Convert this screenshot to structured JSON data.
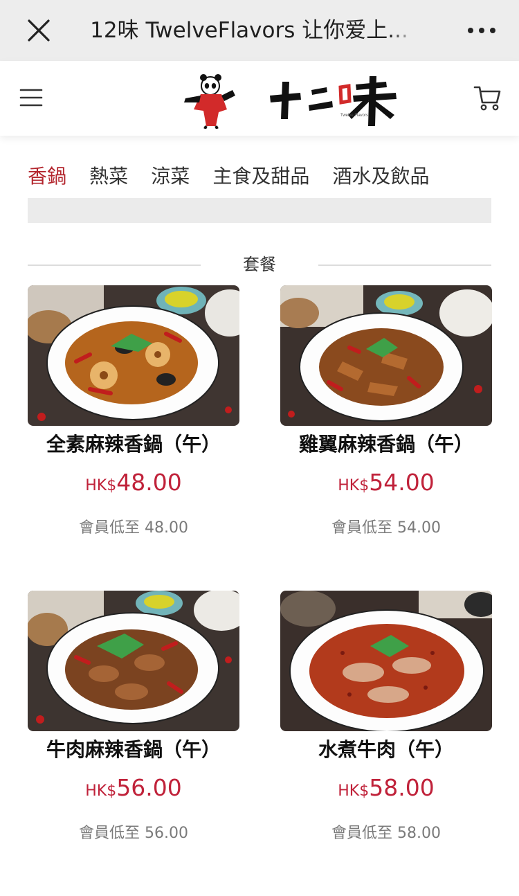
{
  "titlebar": {
    "title": "12味 TwelveFlavors 让你爱上...",
    "close_icon": "close-icon",
    "more_icon": "more-icon"
  },
  "header": {
    "logo_alt": "十二味",
    "menu_icon": "menu-icon",
    "cart_icon": "cart-icon",
    "accent": "#b3262e"
  },
  "tabs": [
    {
      "label": "香鍋",
      "active": true
    },
    {
      "label": "熱菜",
      "active": false
    },
    {
      "label": "涼菜",
      "active": false
    },
    {
      "label": "主食及甜品",
      "active": false
    },
    {
      "label": "酒水及飲品",
      "active": false
    }
  ],
  "section": {
    "title": "套餐"
  },
  "products": [
    {
      "name": "全素麻辣香鍋（午）",
      "currency": "HK$",
      "price": "48.00",
      "member": "會員低至 48.00",
      "dish": "veg"
    },
    {
      "name": "雞翼麻辣香鍋（午）",
      "currency": "HK$",
      "price": "54.00",
      "member": "會員低至 54.00",
      "dish": "wings"
    },
    {
      "name": "牛肉麻辣香鍋（午）",
      "currency": "HK$",
      "price": "56.00",
      "member": "會員低至 56.00",
      "dish": "beef"
    },
    {
      "name": "水煮牛肉（午）",
      "currency": "HK$",
      "price": "58.00",
      "member": "會員低至 58.00",
      "dish": "boiled-beef"
    }
  ],
  "colors": {
    "price": "#c0223a",
    "accent": "#b3262e",
    "topbar": "#ededed"
  }
}
